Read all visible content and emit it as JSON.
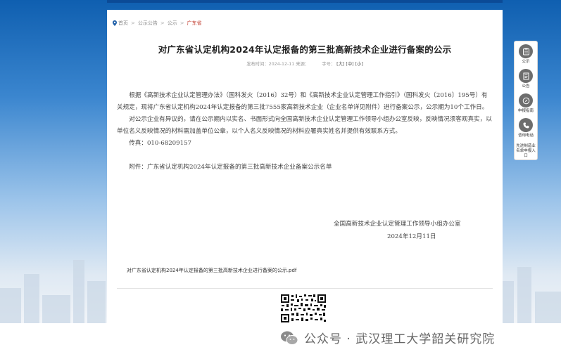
{
  "breadcrumb": {
    "items": [
      "首页",
      "公示公告",
      "公示"
    ],
    "current": "广东省"
  },
  "article": {
    "title": "对广东省认定机构2024年认定报备的第三批高新技术企业进行备案的公示",
    "meta": {
      "publish": "发布时间：2024-12-11",
      "source": "来源：",
      "fontsize_label": "字号：",
      "font_large": "[大]",
      "font_medium": "[中]",
      "font_small": "[小]"
    },
    "paragraph1": "根据《高新技术企业认定管理办法》（国科发火〔2016〕32号）和《高新技术企业认定管理工作指引》（国科发火〔2016〕195号）有关规定，现将广东省认定机构2024年认定报备的第三批7555家高新技术企业（企业名单详见附件）进行备案公示，公示期为10个工作日。",
    "paragraph2": "对公示企业有异议的，请在公示期内以实名、书面形式向全国高新技术企业认定管理工作领导小组办公室反映，反映情况须客观真实，以单位名义反映情况的材料需加盖单位公章，以个人名义反映情况的材料应署真实姓名并提供有效联系方式。",
    "fax": "传真：010-68209157",
    "attachment": "附件：广东省认定机构2024年认定报备的第三批高新技术企业备案公示名单",
    "signature_org": "全国高新技术企业认定管理工作领导小组办公室",
    "signature_date": "2024年12月11日",
    "attachment_link": "对广东省认定机构2024年认定报备的第三批高新技术企业进行备案的公示.pdf"
  },
  "sidebar": {
    "items": [
      {
        "label": "公示",
        "icon": "clipboard-icon"
      },
      {
        "label": "公告",
        "icon": "document-icon"
      },
      {
        "label": "申报指南",
        "icon": "compass-icon"
      },
      {
        "label": "咨询电话",
        "icon": "phone-icon"
      },
      {
        "label": "先进制造业名单申报入口",
        "icon": "none"
      }
    ]
  },
  "watermark": {
    "text": "公众号 · 武汉理工大学韶关研究院",
    "icon": "wechat-icon"
  },
  "colors": {
    "header_blue": "#0b4a96",
    "breadcrumb_current": "#c0392b",
    "sidebar_icon": "#6d6d6d"
  }
}
